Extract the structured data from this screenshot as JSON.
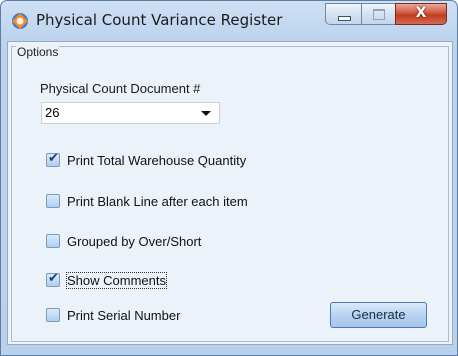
{
  "window": {
    "title": "Physical Count Variance Register",
    "icon": "app-logo-icon",
    "close_glyph": "X"
  },
  "options": {
    "group_label": "Options",
    "document_label": "Physical Count Document #",
    "document_value": "26"
  },
  "checkboxes": [
    {
      "label": "Print Total Warehouse Quantity",
      "checked": true
    },
    {
      "label": "Print Blank Line after each item",
      "checked": false
    },
    {
      "label": "Grouped by Over/Short",
      "checked": false
    },
    {
      "label": "Show Comments",
      "checked": true
    },
    {
      "label": "Print Serial Number",
      "checked": false
    }
  ],
  "actions": {
    "generate_label": "Generate"
  },
  "colors": {
    "accent": "#4c7ab3",
    "frame": "#bcd3ee"
  }
}
